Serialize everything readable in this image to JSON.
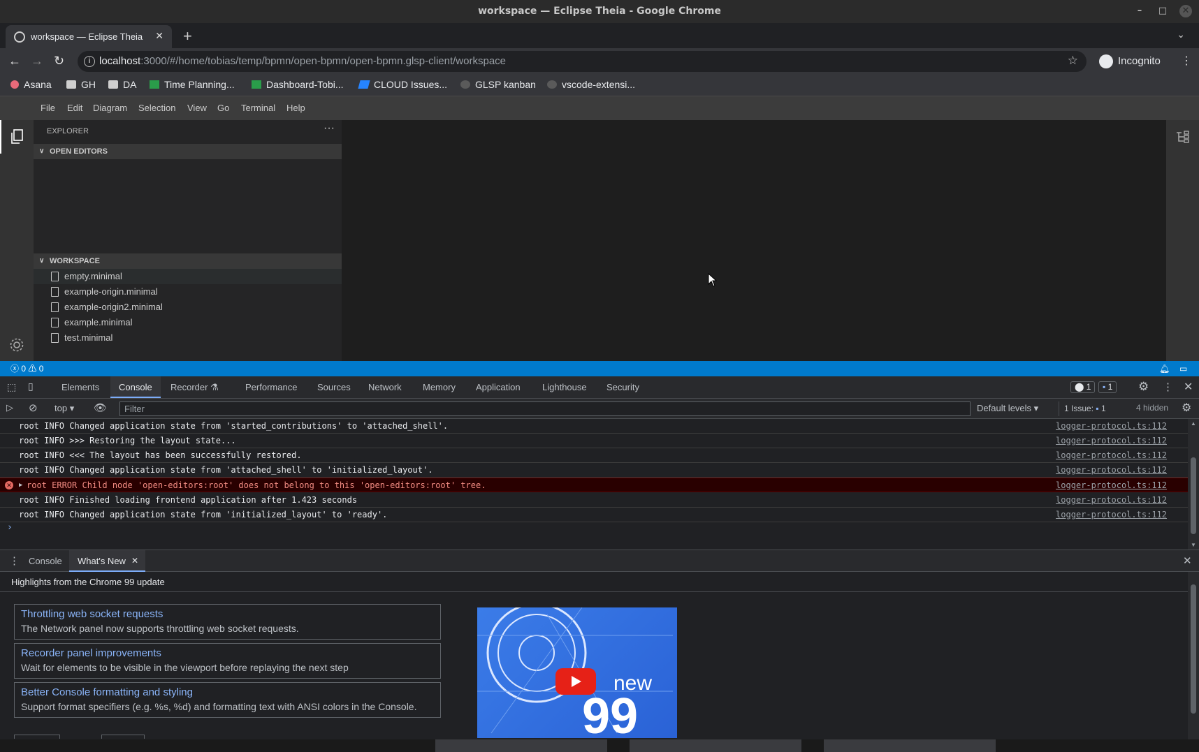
{
  "window": {
    "title": "workspace — Eclipse Theia - Google Chrome"
  },
  "browser": {
    "tab_title": "workspace — Eclipse Theia",
    "url_host": "localhost",
    "url_rest": ":3000/#/home/tobias/temp/bpmn/open-bpmn/open-bpmn.glsp-client/workspace",
    "profile_label": "Incognito",
    "bookmarks": [
      {
        "label": "Asana",
        "icon": "asana-icon"
      },
      {
        "label": "GH",
        "icon": "folder-icon"
      },
      {
        "label": "DA",
        "icon": "folder-icon"
      },
      {
        "label": "Time Planning...",
        "icon": "sheets-icon"
      },
      {
        "label": "Dashboard-Tobi...",
        "icon": "sheets-icon"
      },
      {
        "label": "CLOUD Issues...",
        "icon": "jira-icon"
      },
      {
        "label": "GLSP kanban",
        "icon": "github-icon"
      },
      {
        "label": "vscode-extensi...",
        "icon": "github-icon"
      }
    ]
  },
  "theia": {
    "menu": [
      "File",
      "Edit",
      "Diagram",
      "Selection",
      "View",
      "Go",
      "Terminal",
      "Help"
    ],
    "explorer_title": "EXPLORER",
    "open_editors_label": "OPEN EDITORS",
    "workspace_label": "WORKSPACE",
    "files": [
      "empty.minimal",
      "example-origin.minimal",
      "example-origin2.minimal",
      "example.minimal",
      "test.minimal"
    ],
    "status_errors": "0",
    "status_warnings": "0"
  },
  "devtools": {
    "tabs": [
      "Elements",
      "Console",
      "Recorder",
      "Performance",
      "Sources",
      "Network",
      "Memory",
      "Application",
      "Lighthouse",
      "Security"
    ],
    "active_tab": "Console",
    "error_count": "1",
    "message_count": "1",
    "context": "top",
    "filter_placeholder": "Filter",
    "levels": "Default levels",
    "issues": "1 Issue:",
    "issues_count": "1",
    "hidden": "4 hidden",
    "log": [
      {
        "text": "root INFO Changed application state from 'started_contributions' to 'attached_shell'.",
        "src": "logger-protocol.ts:112",
        "level": "info"
      },
      {
        "text": "root INFO >>> Restoring the layout state...",
        "src": "logger-protocol.ts:112",
        "level": "info"
      },
      {
        "text": "root INFO <<< The layout has been successfully restored.",
        "src": "logger-protocol.ts:112",
        "level": "info"
      },
      {
        "text": "root INFO Changed application state from 'attached_shell' to 'initialized_layout'.",
        "src": "logger-protocol.ts:112",
        "level": "info"
      },
      {
        "text": "root ERROR Child node 'open-editors:root' does not belong to this 'open-editors:root' tree.",
        "src": "logger-protocol.ts:112",
        "level": "error"
      },
      {
        "text": "root INFO Finished loading frontend application after 1.423 seconds",
        "src": "logger-protocol.ts:112",
        "level": "info"
      },
      {
        "text": "root INFO Changed application state from 'initialized_layout' to 'ready'.",
        "src": "logger-protocol.ts:112",
        "level": "info"
      }
    ],
    "drawer_tabs": [
      "Console",
      "What's New"
    ],
    "whats_new": {
      "headline": "Highlights from the Chrome 99 update",
      "cards": [
        {
          "title": "Throttling web socket requests",
          "desc": "The Network panel now supports throttling web socket requests."
        },
        {
          "title": "Recorder panel improvements",
          "desc": "Wait for elements to be visible in the viewport before replaying the next step"
        },
        {
          "title": "Better Console formatting and styling",
          "desc": "Support format specifiers (e.g. %s, %d) and formatting text with ANSI colors in the Console."
        }
      ],
      "video_word": "new",
      "video_number": "99"
    }
  },
  "colors": {
    "theia_status": "#007acc",
    "devtools_link": "#8ab4f8",
    "error_text": "#f28b82"
  }
}
